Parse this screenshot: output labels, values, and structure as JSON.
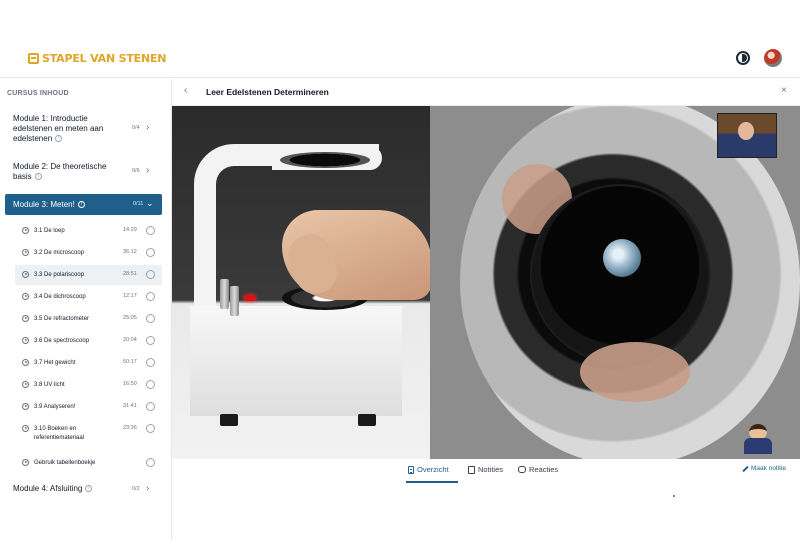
{
  "brand": {
    "name": "STAPEL VAN STENEN",
    "accent": "#e0a526"
  },
  "header": {
    "theme_icon": "moon-icon",
    "avatar": "user-avatar"
  },
  "sidebar": {
    "title": "CURSUS INHOUD",
    "modules": [
      {
        "label": "Module 1: Introductie edelstenen en meten aan edelstenen",
        "count": "0/4",
        "expanded": false
      },
      {
        "label": "Module 2: De theoretische basis",
        "count": "0/6",
        "expanded": false
      },
      {
        "label": "Module 3: Meten!",
        "count": "0/11",
        "expanded": true
      },
      {
        "label": "Module 4: Afsluiting",
        "count": "0/2",
        "expanded": false
      }
    ],
    "lessons": [
      {
        "title": "3.1 De loep",
        "duration": "14:29"
      },
      {
        "title": "3.2 De microscoop",
        "duration": "36:12"
      },
      {
        "title": "3.3 De polariscoop",
        "duration": "28:51",
        "current": true
      },
      {
        "title": "3.4 De dichroscoop",
        "duration": "12:17"
      },
      {
        "title": "3.5 De refractometer",
        "duration": "25:05"
      },
      {
        "title": "3.6 De spectroscoop",
        "duration": "20:04"
      },
      {
        "title": "3.7 Het gewicht",
        "duration": "50:17"
      },
      {
        "title": "3.8 UV licht",
        "duration": "16:50"
      },
      {
        "title": "3.9 Analyseren!",
        "duration": "31:41"
      },
      {
        "title": "3.10 Boeken en referentiemateriaal",
        "duration": "23:36"
      },
      {
        "title": "Gebruik tabellenboekje",
        "duration": ""
      }
    ]
  },
  "main": {
    "title": "Leer Edelstenen Determineren",
    "tabs": [
      {
        "label": "Overzicht",
        "active": true
      },
      {
        "label": "Notities",
        "active": false
      },
      {
        "label": "Reacties",
        "active": false
      }
    ],
    "make_note": "Maak notitie",
    "primary_color": "#1f5f8b"
  }
}
